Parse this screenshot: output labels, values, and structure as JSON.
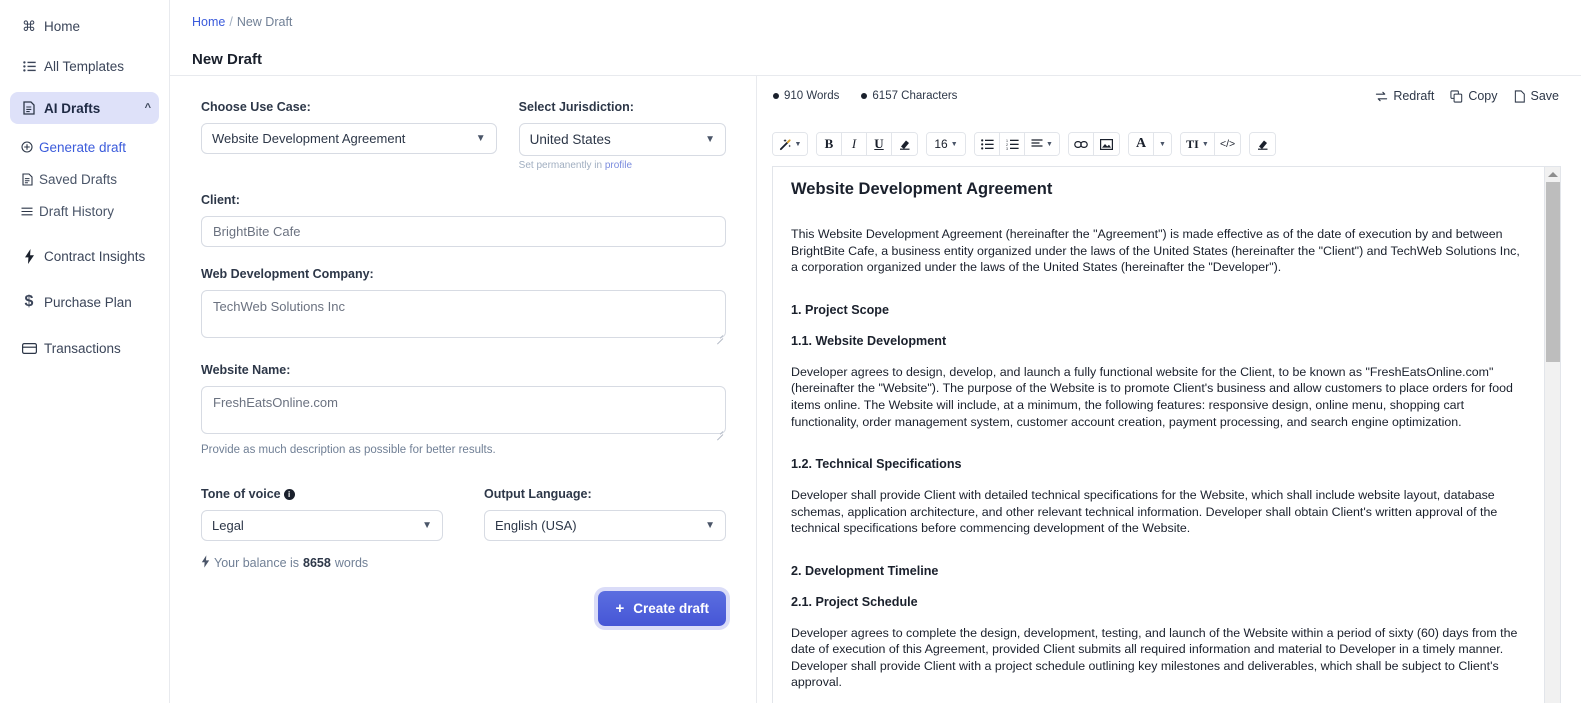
{
  "sidebar": {
    "items": [
      {
        "label": "Home",
        "icon": "command-icon",
        "name": "home"
      },
      {
        "label": "All Templates",
        "icon": "list-icon",
        "name": "all-templates"
      },
      {
        "label": "AI Drafts",
        "icon": "document-icon",
        "name": "ai-drafts",
        "active": true,
        "chevron": "chevron-up-icon"
      }
    ],
    "sub_items": [
      {
        "label": "Generate draft",
        "icon": "plus-circle-icon",
        "name": "generate-draft",
        "accent": true
      },
      {
        "label": "Saved Drafts",
        "icon": "document-icon",
        "name": "saved-drafts"
      },
      {
        "label": "Draft History",
        "icon": "menu-lines-icon",
        "name": "draft-history"
      }
    ],
    "items_bottom": [
      {
        "label": "Contract Insights",
        "icon": "bolt-icon",
        "name": "contract-insights"
      },
      {
        "label": "Purchase Plan",
        "icon": "dollar-icon",
        "name": "purchase-plan"
      },
      {
        "label": "Transactions",
        "icon": "card-icon",
        "name": "transactions"
      }
    ]
  },
  "breadcrumb": {
    "home": "Home",
    "separator": "/",
    "current": "New Draft"
  },
  "page_title": "New Draft",
  "form": {
    "use_case_label": "Choose Use Case:",
    "use_case_value": "Website Development Agreement",
    "jurisdiction_label": "Select Jurisdiction:",
    "jurisdiction_value": "United States",
    "jurisdiction_hint_prefix": "Set permanently in ",
    "jurisdiction_hint_link": "profile",
    "client_label": "Client:",
    "client_value": "BrightBite Cafe",
    "company_label": "Web Development Company:",
    "company_value": "TechWeb Solutions Inc",
    "website_label": "Website Name:",
    "website_value": "FreshEatsOnline.com",
    "website_hint": "Provide as much description as possible for better results.",
    "tone_label": "Tone of voice",
    "tone_info": "i",
    "tone_value": "Legal",
    "language_label": "Output Language:",
    "language_value": "English (USA)",
    "balance_prefix": "Your balance is ",
    "balance_amount": "8658",
    "balance_suffix": " words",
    "create_button": "Create draft",
    "create_plus": "+"
  },
  "editor": {
    "words": "910 Words",
    "characters": "6157 Characters",
    "actions": [
      {
        "label": "Redraft",
        "icon": "redraft-icon",
        "name": "redraft"
      },
      {
        "label": "Copy",
        "icon": "copy-icon",
        "name": "copy"
      },
      {
        "label": "Save",
        "icon": "save-file-icon",
        "name": "save"
      }
    ],
    "toolbar": {
      "magic": "magic-wand-icon",
      "bold": "B",
      "italic": "I",
      "underline": "U",
      "highlight": "highlight-icon",
      "font_size": "16",
      "bullet_list": "bullet-list-icon",
      "numbered_list": "numbered-list-icon",
      "align": "align-icon",
      "link": "link-icon",
      "image": "image-icon",
      "font_color": "A",
      "text_style": "TI",
      "code": "</>",
      "clear_format": "eraser-icon"
    },
    "document": {
      "title": "Website Development Agreement",
      "blocks": [
        {
          "type": "p",
          "text": "This Website Development Agreement (hereinafter the \"Agreement\") is made effective as of the date of execution by and between BrightBite Cafe, a business entity organized under the laws of the United States (hereinafter the \"Client\") and TechWeb Solutions Inc, a corporation organized under the laws of the United States (hereinafter the \"Developer\")."
        },
        {
          "type": "h3",
          "text": "1. Project Scope"
        },
        {
          "type": "h3",
          "text": "1.1. Website Development"
        },
        {
          "type": "p",
          "text": "Developer agrees to design, develop, and launch a fully functional website for the Client, to be known as \"FreshEatsOnline.com\" (hereinafter the \"Website\"). The purpose of the Website is to promote Client's business and allow customers to place orders for food items online. The Website will include, at a minimum, the following features: responsive design, online menu, shopping cart functionality, order management system, customer account creation, payment processing, and search engine optimization."
        },
        {
          "type": "h3",
          "text": "1.2. Technical Specifications"
        },
        {
          "type": "p",
          "text": "Developer shall provide Client with detailed technical specifications for the Website, which shall include website layout, database schemas, application architecture, and other relevant technical information. Developer shall obtain Client's written approval of the technical specifications before commencing development of the Website."
        },
        {
          "type": "h3",
          "text": "2. Development Timeline"
        },
        {
          "type": "h3",
          "text": "2.1. Project Schedule"
        },
        {
          "type": "p",
          "text": "Developer agrees to complete the design, development, testing, and launch of the Website within a period of sixty (60) days from the date of execution of this Agreement, provided Client submits all required information and material to Developer in a timely manner. Developer shall provide Client with a project schedule outlining key milestones and deliverables, which shall be subject to Client's approval."
        }
      ]
    }
  },
  "colors": {
    "accent": "#3b5bdb",
    "active_bg": "#dee1f9",
    "button": "#4656d6",
    "border": "#e8eaee"
  }
}
